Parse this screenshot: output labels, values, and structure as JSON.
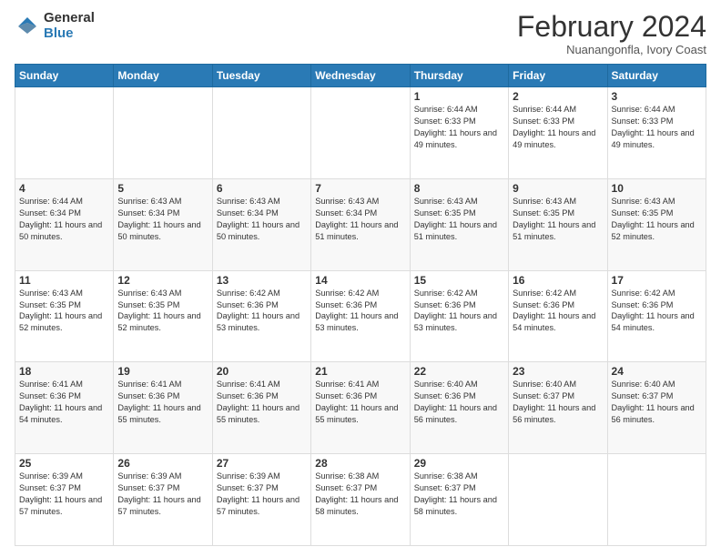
{
  "logo": {
    "general": "General",
    "blue": "Blue"
  },
  "header": {
    "title": "February 2024",
    "subtitle": "Nuanangonfla, Ivory Coast"
  },
  "days_of_week": [
    "Sunday",
    "Monday",
    "Tuesday",
    "Wednesday",
    "Thursday",
    "Friday",
    "Saturday"
  ],
  "weeks": [
    [
      {
        "day": "",
        "info": ""
      },
      {
        "day": "",
        "info": ""
      },
      {
        "day": "",
        "info": ""
      },
      {
        "day": "",
        "info": ""
      },
      {
        "day": "1",
        "info": "Sunrise: 6:44 AM\nSunset: 6:33 PM\nDaylight: 11 hours and 49 minutes."
      },
      {
        "day": "2",
        "info": "Sunrise: 6:44 AM\nSunset: 6:33 PM\nDaylight: 11 hours and 49 minutes."
      },
      {
        "day": "3",
        "info": "Sunrise: 6:44 AM\nSunset: 6:33 PM\nDaylight: 11 hours and 49 minutes."
      }
    ],
    [
      {
        "day": "4",
        "info": "Sunrise: 6:44 AM\nSunset: 6:34 PM\nDaylight: 11 hours and 50 minutes."
      },
      {
        "day": "5",
        "info": "Sunrise: 6:43 AM\nSunset: 6:34 PM\nDaylight: 11 hours and 50 minutes."
      },
      {
        "day": "6",
        "info": "Sunrise: 6:43 AM\nSunset: 6:34 PM\nDaylight: 11 hours and 50 minutes."
      },
      {
        "day": "7",
        "info": "Sunrise: 6:43 AM\nSunset: 6:34 PM\nDaylight: 11 hours and 51 minutes."
      },
      {
        "day": "8",
        "info": "Sunrise: 6:43 AM\nSunset: 6:35 PM\nDaylight: 11 hours and 51 minutes."
      },
      {
        "day": "9",
        "info": "Sunrise: 6:43 AM\nSunset: 6:35 PM\nDaylight: 11 hours and 51 minutes."
      },
      {
        "day": "10",
        "info": "Sunrise: 6:43 AM\nSunset: 6:35 PM\nDaylight: 11 hours and 52 minutes."
      }
    ],
    [
      {
        "day": "11",
        "info": "Sunrise: 6:43 AM\nSunset: 6:35 PM\nDaylight: 11 hours and 52 minutes."
      },
      {
        "day": "12",
        "info": "Sunrise: 6:43 AM\nSunset: 6:35 PM\nDaylight: 11 hours and 52 minutes."
      },
      {
        "day": "13",
        "info": "Sunrise: 6:42 AM\nSunset: 6:36 PM\nDaylight: 11 hours and 53 minutes."
      },
      {
        "day": "14",
        "info": "Sunrise: 6:42 AM\nSunset: 6:36 PM\nDaylight: 11 hours and 53 minutes."
      },
      {
        "day": "15",
        "info": "Sunrise: 6:42 AM\nSunset: 6:36 PM\nDaylight: 11 hours and 53 minutes."
      },
      {
        "day": "16",
        "info": "Sunrise: 6:42 AM\nSunset: 6:36 PM\nDaylight: 11 hours and 54 minutes."
      },
      {
        "day": "17",
        "info": "Sunrise: 6:42 AM\nSunset: 6:36 PM\nDaylight: 11 hours and 54 minutes."
      }
    ],
    [
      {
        "day": "18",
        "info": "Sunrise: 6:41 AM\nSunset: 6:36 PM\nDaylight: 11 hours and 54 minutes."
      },
      {
        "day": "19",
        "info": "Sunrise: 6:41 AM\nSunset: 6:36 PM\nDaylight: 11 hours and 55 minutes."
      },
      {
        "day": "20",
        "info": "Sunrise: 6:41 AM\nSunset: 6:36 PM\nDaylight: 11 hours and 55 minutes."
      },
      {
        "day": "21",
        "info": "Sunrise: 6:41 AM\nSunset: 6:36 PM\nDaylight: 11 hours and 55 minutes."
      },
      {
        "day": "22",
        "info": "Sunrise: 6:40 AM\nSunset: 6:36 PM\nDaylight: 11 hours and 56 minutes."
      },
      {
        "day": "23",
        "info": "Sunrise: 6:40 AM\nSunset: 6:37 PM\nDaylight: 11 hours and 56 minutes."
      },
      {
        "day": "24",
        "info": "Sunrise: 6:40 AM\nSunset: 6:37 PM\nDaylight: 11 hours and 56 minutes."
      }
    ],
    [
      {
        "day": "25",
        "info": "Sunrise: 6:39 AM\nSunset: 6:37 PM\nDaylight: 11 hours and 57 minutes."
      },
      {
        "day": "26",
        "info": "Sunrise: 6:39 AM\nSunset: 6:37 PM\nDaylight: 11 hours and 57 minutes."
      },
      {
        "day": "27",
        "info": "Sunrise: 6:39 AM\nSunset: 6:37 PM\nDaylight: 11 hours and 57 minutes."
      },
      {
        "day": "28",
        "info": "Sunrise: 6:38 AM\nSunset: 6:37 PM\nDaylight: 11 hours and 58 minutes."
      },
      {
        "day": "29",
        "info": "Sunrise: 6:38 AM\nSunset: 6:37 PM\nDaylight: 11 hours and 58 minutes."
      },
      {
        "day": "",
        "info": ""
      },
      {
        "day": "",
        "info": ""
      }
    ]
  ]
}
